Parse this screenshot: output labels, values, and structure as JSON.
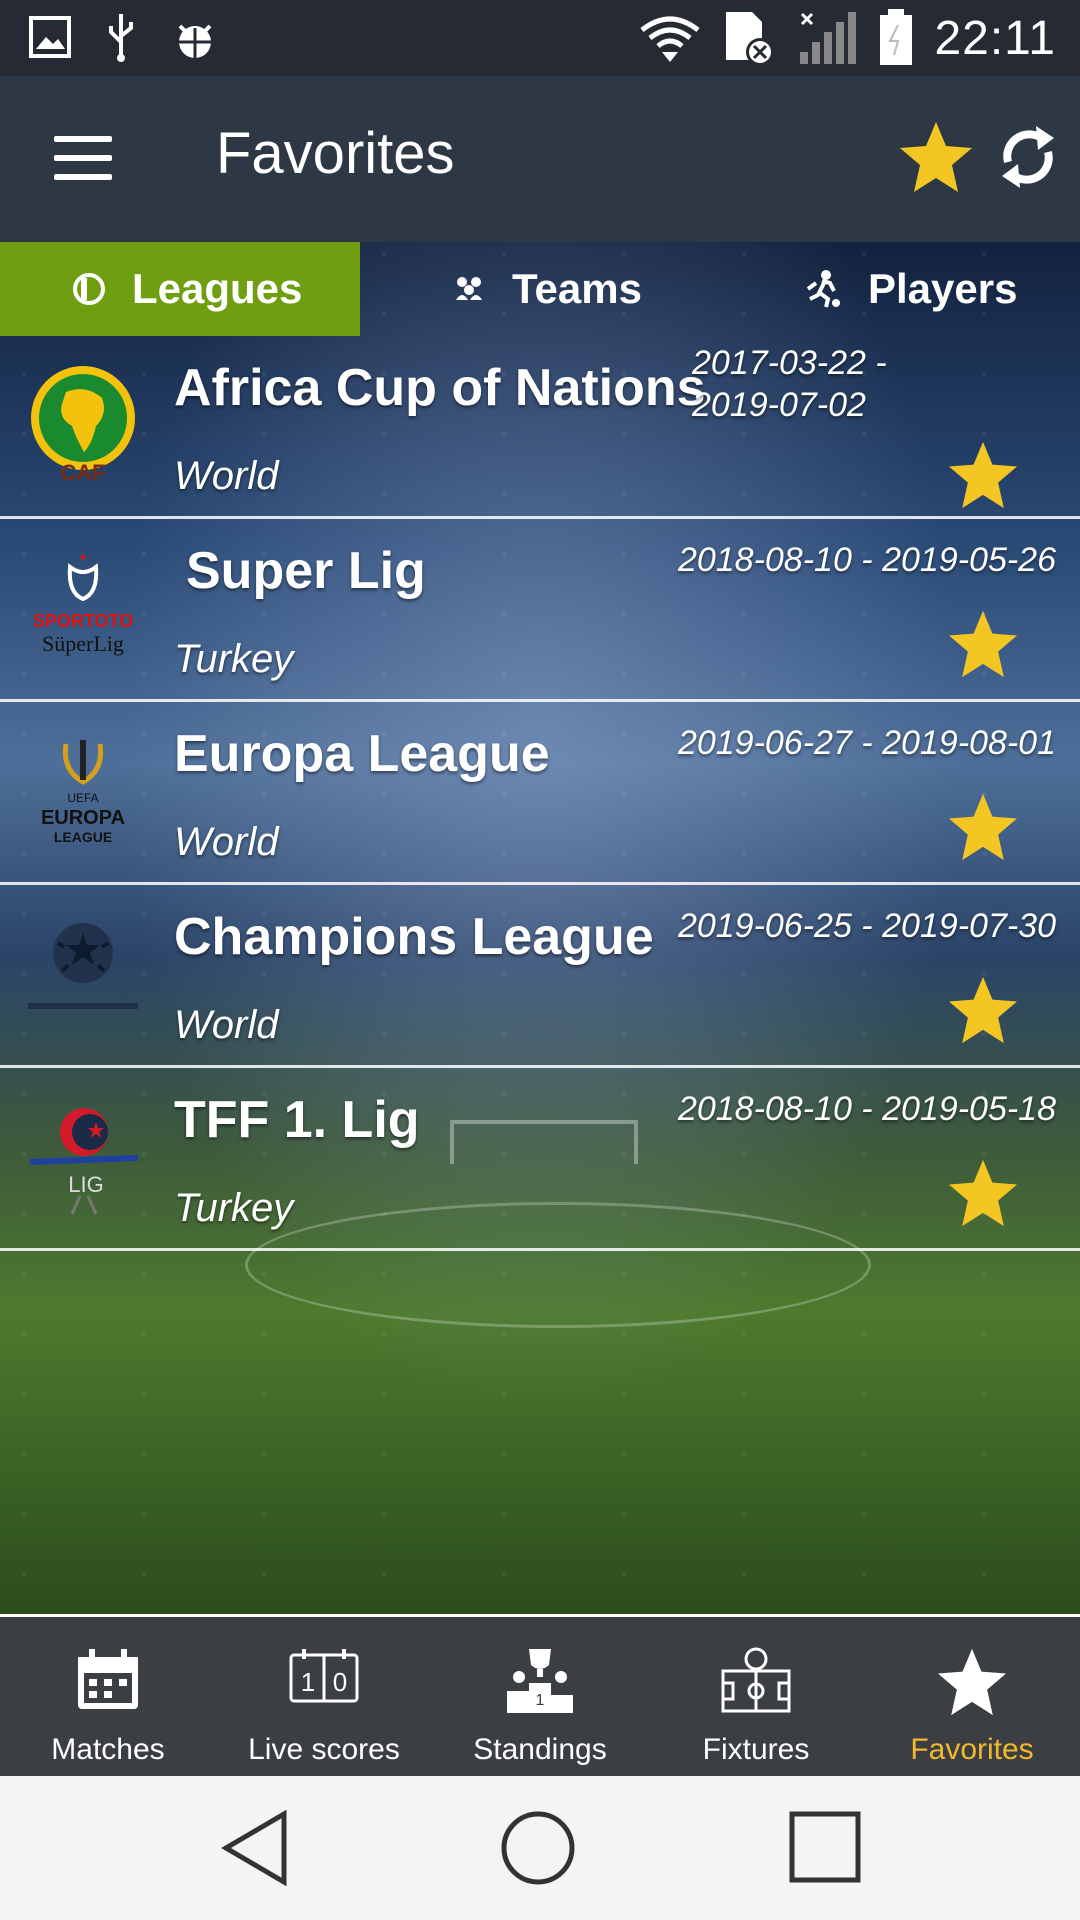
{
  "status_bar": {
    "time": "22:11"
  },
  "app_bar": {
    "title": "Favorites"
  },
  "tabs": [
    {
      "label": "Leagues",
      "icon": "league-icon",
      "active": true
    },
    {
      "label": "Teams",
      "icon": "teams-icon",
      "active": false
    },
    {
      "label": "Players",
      "icon": "player-icon",
      "active": false
    }
  ],
  "leagues": [
    {
      "name": "Africa Cup of Nations",
      "country": "World",
      "dates_line1": "2017-03-22 -",
      "dates_line2": "2019-07-02",
      "logo_text": "CAF"
    },
    {
      "name": "Super Lig",
      "country": "Turkey",
      "dates": "2018-08-10 - 2019-05-26",
      "logo_text_1": "SPORTOTO",
      "logo_text_2": "SüperLig"
    },
    {
      "name": "Europa League",
      "country": "World",
      "dates": "2019-06-27 - 2019-08-01",
      "logo_text_1": "UEFA",
      "logo_text_2": "EUROPA",
      "logo_text_3": "LEAGUE"
    },
    {
      "name": "Champions League",
      "country": "World",
      "dates": "2019-06-25 - 2019-07-30"
    },
    {
      "name": "TFF 1. Lig",
      "country": "Turkey",
      "dates": "2018-08-10 - 2019-05-18",
      "logo_text": "LIG"
    }
  ],
  "bottom_nav": [
    {
      "label": "Matches",
      "icon": "calendar-icon",
      "active": false
    },
    {
      "label": "Live scores",
      "icon": "scoreboard-icon",
      "active": false
    },
    {
      "label": "Standings",
      "icon": "podium-icon",
      "active": false
    },
    {
      "label": "Fixtures",
      "icon": "pitch-icon",
      "active": false
    },
    {
      "label": "Favorites",
      "icon": "star-icon",
      "active": true
    }
  ],
  "colors": {
    "accent_green": "#6f9f10",
    "star_yellow": "#f3c623",
    "active_nav": "#f3b92a"
  }
}
